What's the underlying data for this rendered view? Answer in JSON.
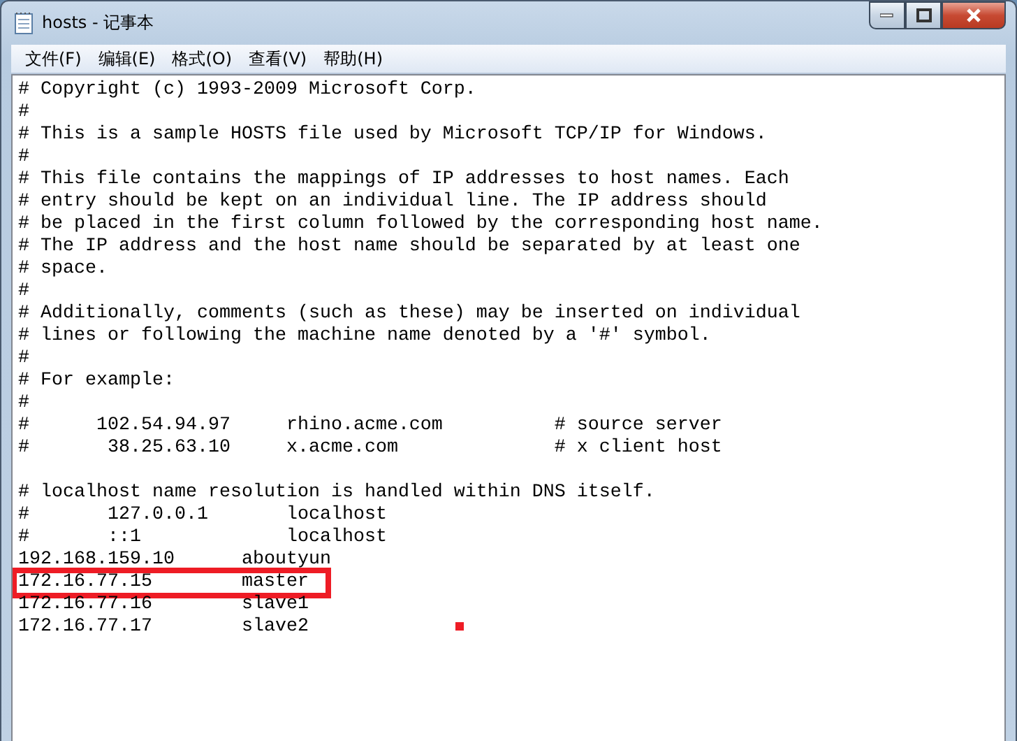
{
  "window": {
    "title": "hosts - 记事本"
  },
  "menu": [
    "文件(F)",
    "编辑(E)",
    "格式(O)",
    "查看(V)",
    "帮助(H)"
  ],
  "lines": [
    {
      "text": "# Copyright (c) 1993-2009 Microsoft Corp.",
      "highlighted": false
    },
    {
      "text": "#",
      "highlighted": false
    },
    {
      "text": "# This is a sample HOSTS file used by Microsoft TCP/IP for Windows.",
      "highlighted": false
    },
    {
      "text": "#",
      "highlighted": false
    },
    {
      "text": "# This file contains the mappings of IP addresses to host names. Each",
      "highlighted": false
    },
    {
      "text": "# entry should be kept on an individual line. The IP address should",
      "highlighted": false
    },
    {
      "text": "# be placed in the first column followed by the corresponding host name.",
      "highlighted": false
    },
    {
      "text": "# The IP address and the host name should be separated by at least one",
      "highlighted": false
    },
    {
      "text": "# space.",
      "highlighted": false
    },
    {
      "text": "#",
      "highlighted": false
    },
    {
      "text": "# Additionally, comments (such as these) may be inserted on individual",
      "highlighted": false
    },
    {
      "text": "# lines or following the machine name denoted by a '#' symbol.",
      "highlighted": false
    },
    {
      "text": "#",
      "highlighted": false
    },
    {
      "text": "# For example:",
      "highlighted": false
    },
    {
      "text": "#",
      "highlighted": false
    },
    {
      "text": "#      102.54.94.97     rhino.acme.com          # source server",
      "highlighted": false
    },
    {
      "text": "#       38.25.63.10     x.acme.com              # x client host",
      "highlighted": false
    },
    {
      "highlighted": false
    },
    {
      "text": "# localhost name resolution is handled within DNS itself.",
      "highlighted": false
    },
    {
      "text": "#       127.0.0.1       localhost",
      "highlighted": false
    },
    {
      "text": "#       ::1             localhost",
      "highlighted": false
    },
    {
      "text": "192.168.159.10      aboutyun",
      "highlighted": false
    },
    {
      "text": "172.16.77.15        master",
      "highlighted": true
    },
    {
      "text": "172.16.77.16        slave1",
      "highlighted": false
    },
    {
      "text": "172.16.77.17        slave2",
      "highlighted": false
    }
  ]
}
